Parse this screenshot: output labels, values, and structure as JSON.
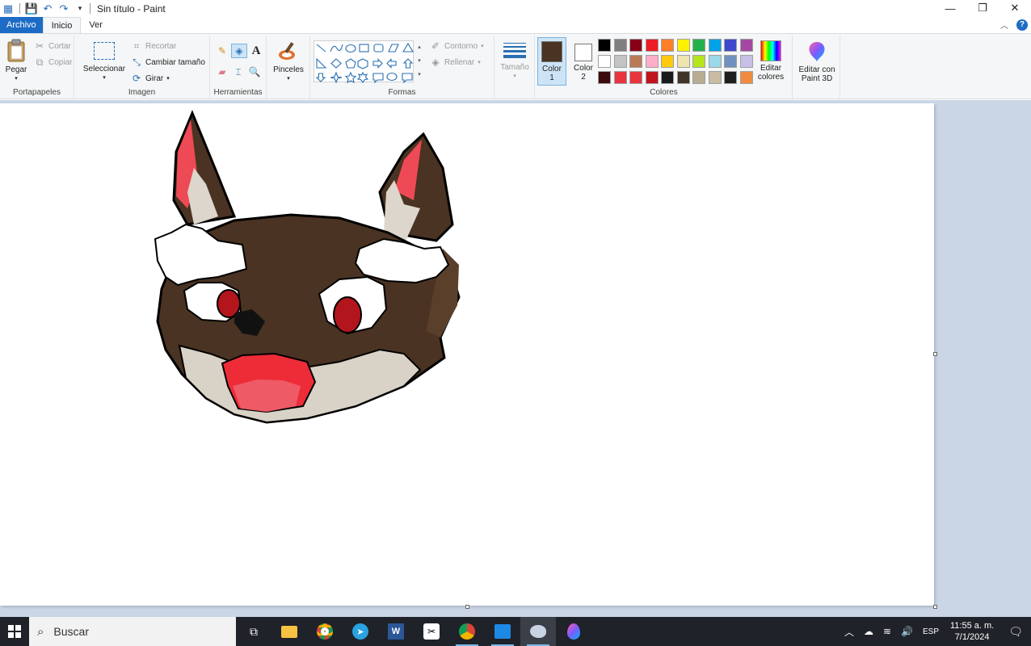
{
  "titlebar": {
    "title": "Sin título - Paint"
  },
  "tabs": {
    "file": "Archivo",
    "home": "Inicio",
    "view": "Ver"
  },
  "clipboard": {
    "paste": "Pegar",
    "cut": "Cortar",
    "copy": "Copiar",
    "group": "Portapapeles"
  },
  "image": {
    "select": "Seleccionar",
    "crop": "Recortar",
    "resize": "Cambiar tamaño",
    "rotate": "Girar",
    "group": "Imagen"
  },
  "tools": {
    "group": "Herramientas"
  },
  "brushes": {
    "label": "Pinceles"
  },
  "shapes": {
    "outline": "Contorno",
    "fill": "Rellenar",
    "group": "Formas"
  },
  "size": {
    "label": "Tamaño"
  },
  "colors": {
    "color1": "Color 1",
    "color2": "Color 2",
    "color1_value": "#4a3322",
    "color2_value": "#ffffff",
    "edit": "Editar colores",
    "paint3d": "Editar con Paint 3D",
    "group": "Colores",
    "palette": [
      "#000000",
      "#7f7f7f",
      "#880015",
      "#ed1c24",
      "#ff7f27",
      "#fff200",
      "#22b14c",
      "#00a2e8",
      "#3f48cc",
      "#a349a4",
      "#ffffff",
      "#c3c3c3",
      "#b97a57",
      "#ffaec9",
      "#ffc90e",
      "#efe4b0",
      "#b5e61d",
      "#99d9ea",
      "#7092be",
      "#c8bfe7",
      "#3b0a0a",
      "#e8343f",
      "#e8343f",
      "#c0141d",
      "#1a1a1a",
      "#3e3528",
      "#b8ac92",
      "#c9bca3",
      "#1e1e1e",
      "#f08a3e"
    ]
  },
  "taskbar": {
    "search": "Buscar",
    "lang": "ESP",
    "time": "11:55 a. m.",
    "date": "7/1/2024"
  }
}
